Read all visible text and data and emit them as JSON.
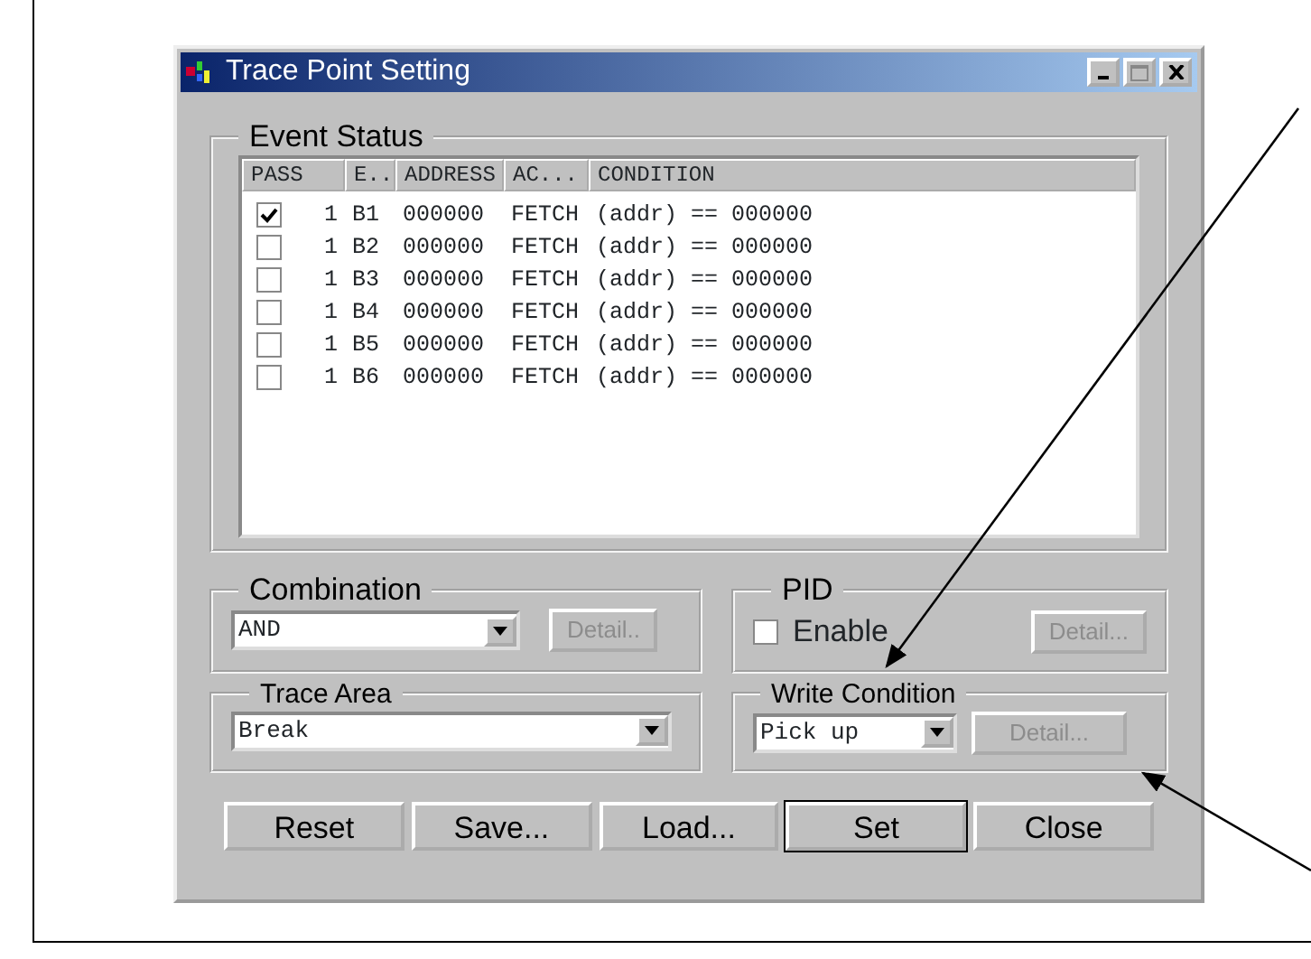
{
  "window": {
    "title": "Trace Point Setting"
  },
  "event_status": {
    "label": "Event Status",
    "columns": [
      "PASS",
      "E..",
      "ADDRESS",
      "AC...",
      "CONDITION"
    ],
    "rows": [
      {
        "pass": true,
        "count": "1",
        "event": "B1",
        "address": "000000",
        "access": "FETCH",
        "condition": "(addr) == 000000"
      },
      {
        "pass": false,
        "count": "1",
        "event": "B2",
        "address": "000000",
        "access": "FETCH",
        "condition": "(addr) == 000000"
      },
      {
        "pass": false,
        "count": "1",
        "event": "B3",
        "address": "000000",
        "access": "FETCH",
        "condition": "(addr) == 000000"
      },
      {
        "pass": false,
        "count": "1",
        "event": "B4",
        "address": "000000",
        "access": "FETCH",
        "condition": "(addr) == 000000"
      },
      {
        "pass": false,
        "count": "1",
        "event": "B5",
        "address": "000000",
        "access": "FETCH",
        "condition": "(addr) == 000000"
      },
      {
        "pass": false,
        "count": "1",
        "event": "B6",
        "address": "000000",
        "access": "FETCH",
        "condition": "(addr) == 000000"
      }
    ]
  },
  "combination": {
    "label": "Combination",
    "value": "AND",
    "detail": {
      "label": "Detail..",
      "disabled": true
    }
  },
  "pid": {
    "label": "PID",
    "enable": {
      "label": "Enable",
      "checked": false
    },
    "detail": {
      "label": "Detail...",
      "disabled": true
    }
  },
  "trace_area": {
    "label": "Trace Area",
    "value": "Break"
  },
  "write_condition": {
    "label": "Write Condition",
    "value": "Pick up",
    "detail": {
      "label": "Detail...",
      "disabled": true
    }
  },
  "buttons": [
    {
      "label": "Reset",
      "default": false
    },
    {
      "label": "Save...",
      "default": false
    },
    {
      "label": "Load...",
      "default": false
    },
    {
      "label": "Set",
      "default": true
    },
    {
      "label": "Close",
      "default": false
    }
  ]
}
